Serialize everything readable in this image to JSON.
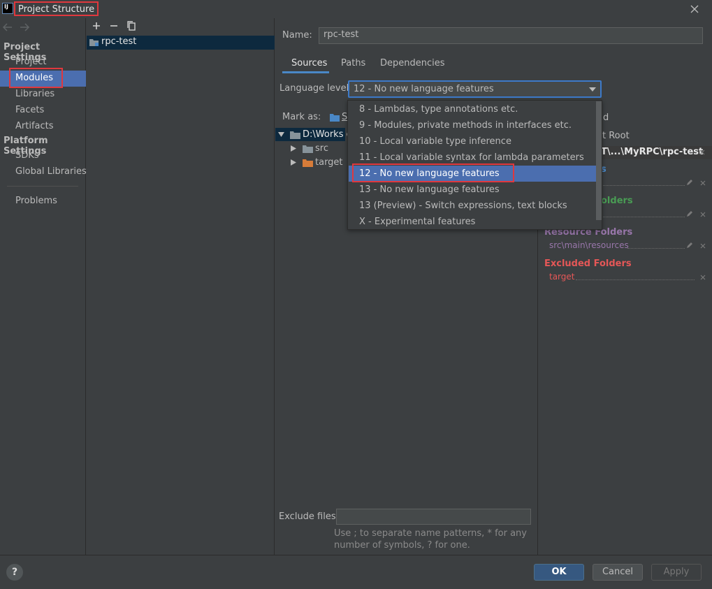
{
  "window": {
    "title": "Project Structure",
    "logo_text": "IJ"
  },
  "nav": {
    "project_settings_header": "Project Settings",
    "platform_settings_header": "Platform Settings",
    "items": [
      "Project",
      "Modules",
      "Libraries",
      "Facets",
      "Artifacts"
    ],
    "platform_items": [
      "SDKs",
      "Global Libraries"
    ],
    "problems": "Problems"
  },
  "modules": {
    "items": [
      "rpc-test"
    ]
  },
  "main": {
    "name_label": "Name:",
    "name_value": "rpc-test",
    "tabs": [
      "Sources",
      "Paths",
      "Dependencies"
    ],
    "language_level_label": "Language level:",
    "language_level_value": "12 - No new language features",
    "mark_as_label": "Mark as:",
    "mark_as_partial": "S",
    "tree": {
      "root": "D:\\Works o",
      "children": [
        "src",
        "target"
      ]
    },
    "right_panel": {
      "partial_header": "d",
      "content_root_label": "t Root",
      "content_root_path": "T\\...\\MyRPC\\rpc-test",
      "source_header_partial": "s",
      "test_header_partial": "olders",
      "resource_header": "Resource Folders",
      "resource_path": "src\\main\\resources",
      "excluded_header": "Excluded Folders",
      "excluded_path": "target"
    },
    "exclude_files_label": "Exclude files:",
    "exclude_hint_line1": "Use ; to separate name patterns, * for any",
    "exclude_hint_line2": "number of symbols, ? for one."
  },
  "dropdown": {
    "options": [
      "8 - Lambdas, type annotations etc.",
      "9 - Modules, private methods in interfaces etc.",
      "10 - Local variable type inference",
      "11 - Local variable syntax for lambda parameters",
      "12 - No new language features",
      "13 - No new language features",
      "13 (Preview) - Switch expressions, text blocks",
      "X - Experimental features"
    ],
    "selected_index": 4
  },
  "footer": {
    "help": "?",
    "ok": "OK",
    "cancel": "Cancel",
    "apply": "Apply"
  },
  "colors": {
    "background": "#3c3f41",
    "selection": "#4b6eaf",
    "annotation_red": "#e0383e",
    "source_blue": "#4a88c7",
    "test_green": "#499c54",
    "resource_purple": "#9876aa",
    "excluded_red": "#e55757",
    "folder_orange": "#d77c39"
  }
}
